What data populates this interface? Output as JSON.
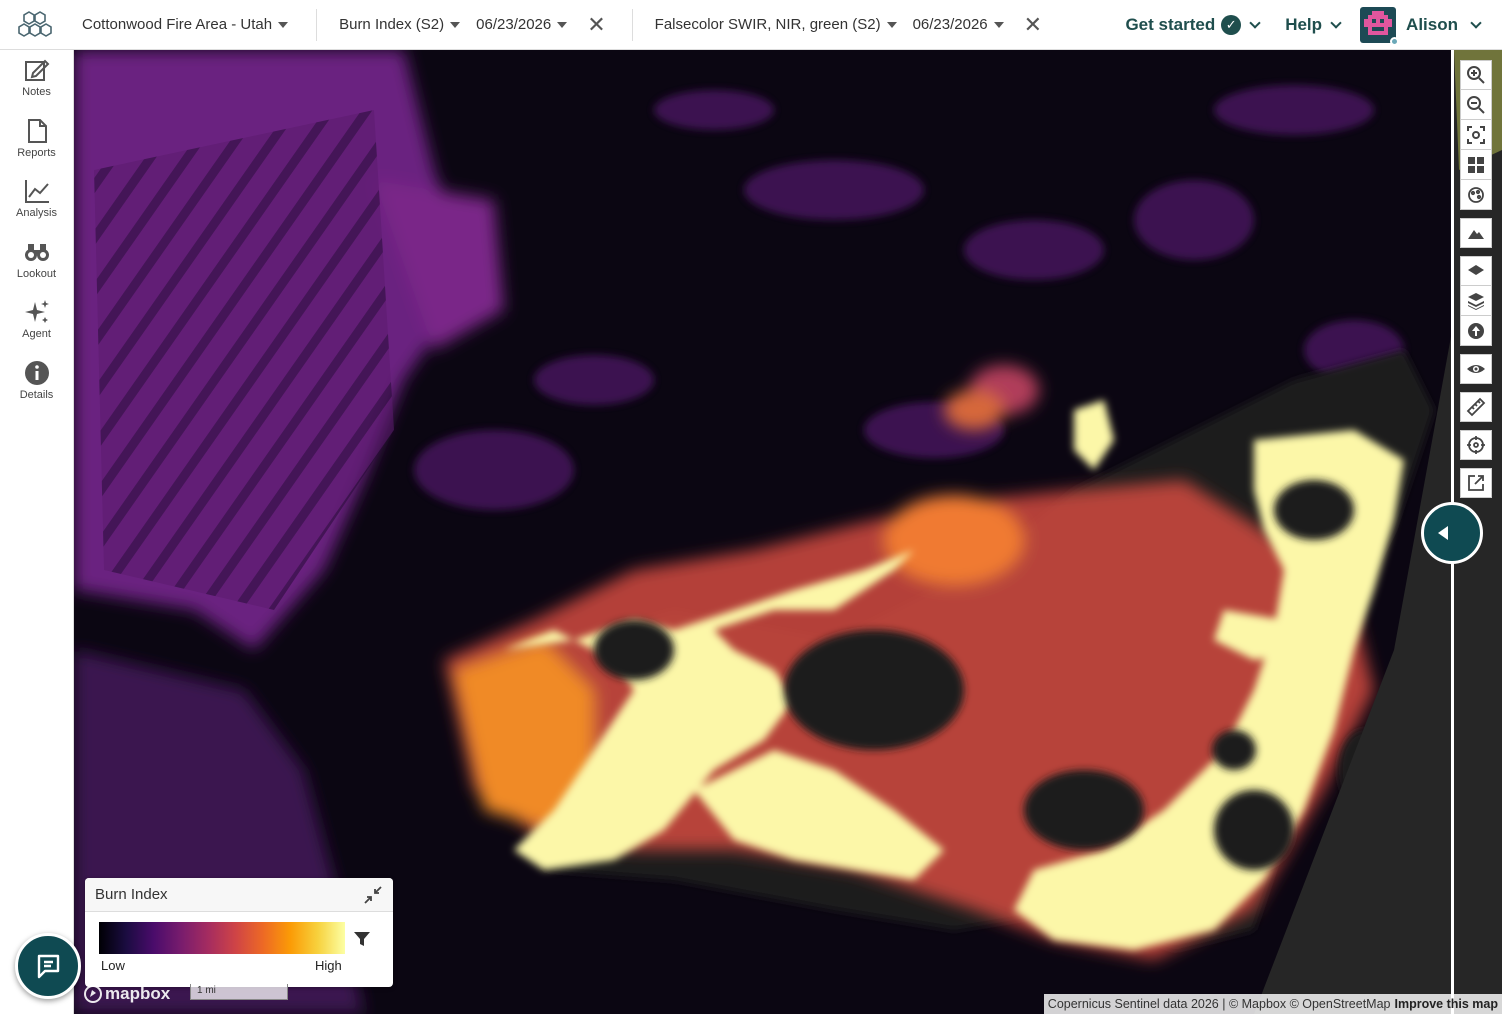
{
  "header": {
    "project": "Cottonwood Fire Area - Utah",
    "left_layer": {
      "name": "Burn Index (S2)",
      "date": "06/23/2026"
    },
    "right_layer": {
      "name": "Falsecolor SWIR, NIR, green (S2)",
      "date": "06/23/2026"
    },
    "get_started": "Get started",
    "help": "Help",
    "user": "Alison"
  },
  "sidebar": {
    "items": [
      {
        "label": "Notes",
        "icon": "notes-icon"
      },
      {
        "label": "Reports",
        "icon": "reports-icon"
      },
      {
        "label": "Analysis",
        "icon": "analysis-icon"
      },
      {
        "label": "Lookout",
        "icon": "binoculars-icon"
      },
      {
        "label": "Agent",
        "icon": "sparkle-icon"
      },
      {
        "label": "Details",
        "icon": "info-icon"
      }
    ]
  },
  "legend": {
    "title": "Burn Index",
    "low": "Low",
    "high": "High",
    "colors": [
      "#000004",
      "#1b0c41",
      "#4a0c6b",
      "#781c6d",
      "#a52c60",
      "#cf4446",
      "#ed6925",
      "#fb9b06",
      "#f7d13d",
      "#fcffa4"
    ]
  },
  "map": {
    "brand": "mapbox",
    "scale": "1 mi",
    "attribution": "Copernicus Sentinel data 2026 | © Mapbox © OpenStreetMap",
    "improve": "Improve this map"
  },
  "colors": {
    "accent": "#1f4e4d",
    "dark_teal": "#0f4a52"
  }
}
